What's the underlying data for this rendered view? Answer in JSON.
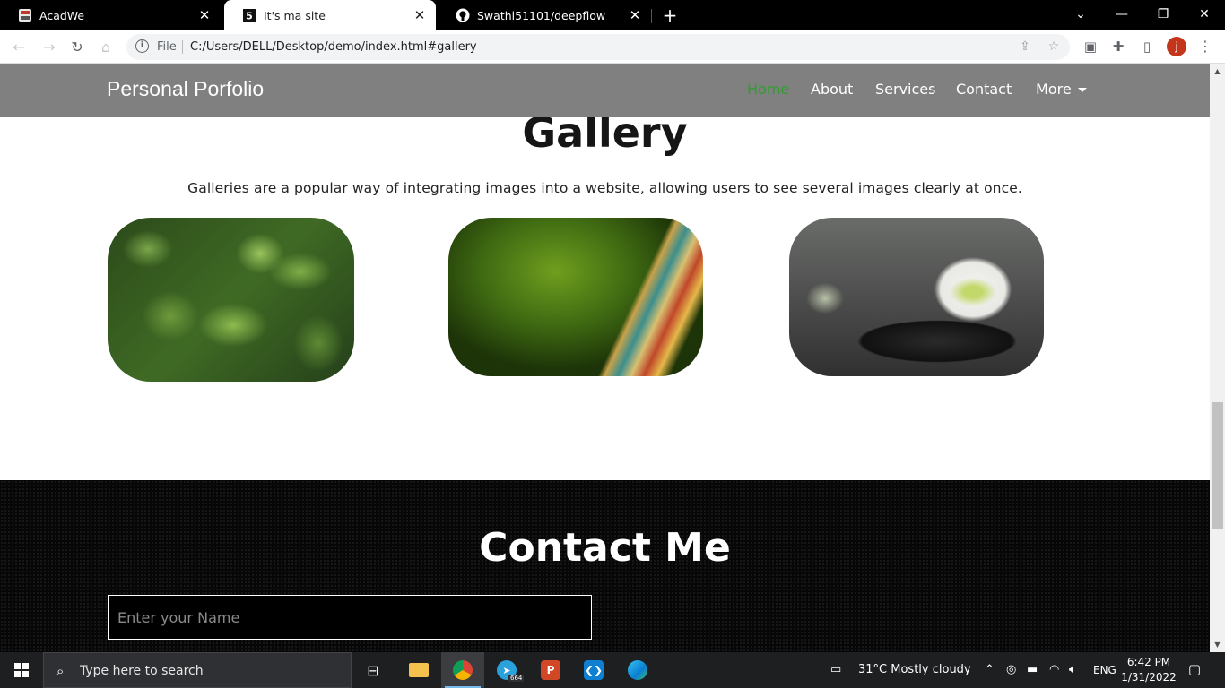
{
  "browser": {
    "tabs": [
      {
        "title": "AcadWe",
        "active": false,
        "favicon": "acadwe-favicon"
      },
      {
        "title": "It's ma site",
        "active": true,
        "favicon": "site-favicon"
      },
      {
        "title": "Swathi51101/deepflow",
        "active": false,
        "favicon": "github-icon"
      }
    ],
    "new_tab_symbol": "+",
    "address": {
      "scheme_label": "File",
      "url": "C:/Users/DELL/Desktop/demo/index.html#gallery"
    },
    "profile_initial": "j"
  },
  "site": {
    "brand": "Personal Porfolio",
    "nav": [
      {
        "label": "Home",
        "active": true
      },
      {
        "label": "About",
        "active": false
      },
      {
        "label": "Services",
        "active": false
      },
      {
        "label": "Contact",
        "active": false
      },
      {
        "label": "More",
        "active": false,
        "dropdown": true
      }
    ],
    "gallery": {
      "title": "Gallery",
      "description": "Galleries are a popular way of integrating images into a website, allowing users to see several images clearly at once.",
      "images": [
        {
          "subject": "green leaves"
        },
        {
          "subject": "colorful rope on green background"
        },
        {
          "subject": "white flower on black stone"
        }
      ]
    },
    "contact": {
      "title": "Contact Me",
      "name_placeholder": "Enter your Name"
    }
  },
  "taskbar": {
    "search_placeholder": "Type here to search",
    "telegram_badge": "664",
    "weather": "31°C  Mostly cloudy",
    "language": "ENG",
    "time": "6:42 PM",
    "date": "1/31/2022"
  },
  "colors": {
    "nav_bg": "#808080",
    "nav_active": "#2e9e2e",
    "contact_bg": "#070707",
    "taskbar_bg": "#1d1f21"
  }
}
